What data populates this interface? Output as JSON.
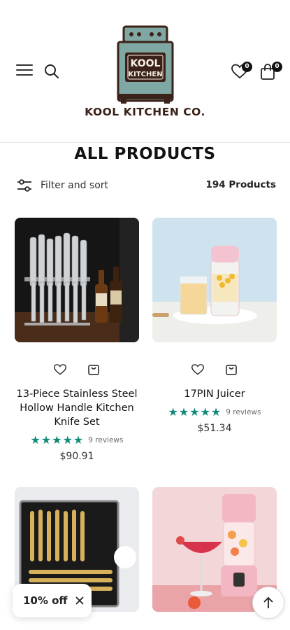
{
  "header": {
    "menu_icon": "hamburger-menu-icon",
    "search_icon": "search-icon",
    "logo_sign_top": "KOOL",
    "logo_sign_bottom": "KITCHEN",
    "logo_name": "KOOL KITCHEN CO.",
    "wishlist_icon": "heart-icon",
    "wishlist_count": "0",
    "cart_icon": "shopping-bag-icon",
    "cart_count": "0"
  },
  "page": {
    "title": "ALL PRODUCTS",
    "filter_label": "Filter and sort",
    "filter_icon": "sliders-icon",
    "product_count": "194 Products"
  },
  "products": [
    {
      "title": "13-Piece Stainless Steel Hollow Handle Kitchen Knife Set",
      "stars": "★★★★★",
      "reviews": "9 reviews",
      "price": "$90.91",
      "rating": 5
    },
    {
      "title": "17PIN Juicer",
      "stars": "★★★★★",
      "reviews": "9 reviews",
      "price": "$51.34",
      "rating": 5
    },
    {
      "title": "",
      "image": "gold flatware set"
    },
    {
      "title": "",
      "image": "pink portable blender"
    }
  ],
  "popup": {
    "discount_label": "10% off",
    "close_icon": "close-icon"
  },
  "scroll_top_icon": "arrow-up-icon",
  "colors": {
    "accent_star": "#0f8a78",
    "logo_teal": "#7fa7a4",
    "logo_brown": "#3b2218"
  }
}
